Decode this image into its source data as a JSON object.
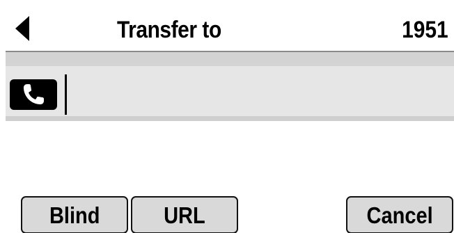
{
  "header": {
    "back_icon": "back-arrow-icon",
    "title": "Transfer to",
    "line_number": "1951"
  },
  "dial": {
    "icon": "phone-handset-icon",
    "value": "",
    "placeholder": ""
  },
  "softkeys": [
    {
      "label": "Blind"
    },
    {
      "label": "URL"
    },
    {
      "label": "Cancel"
    }
  ],
  "colors": {
    "background": "#ffffff",
    "input_row": "#e6e6e6",
    "shade": "#d3d3d3",
    "softkey_fill": "#d9d9d9",
    "text": "#000000"
  }
}
